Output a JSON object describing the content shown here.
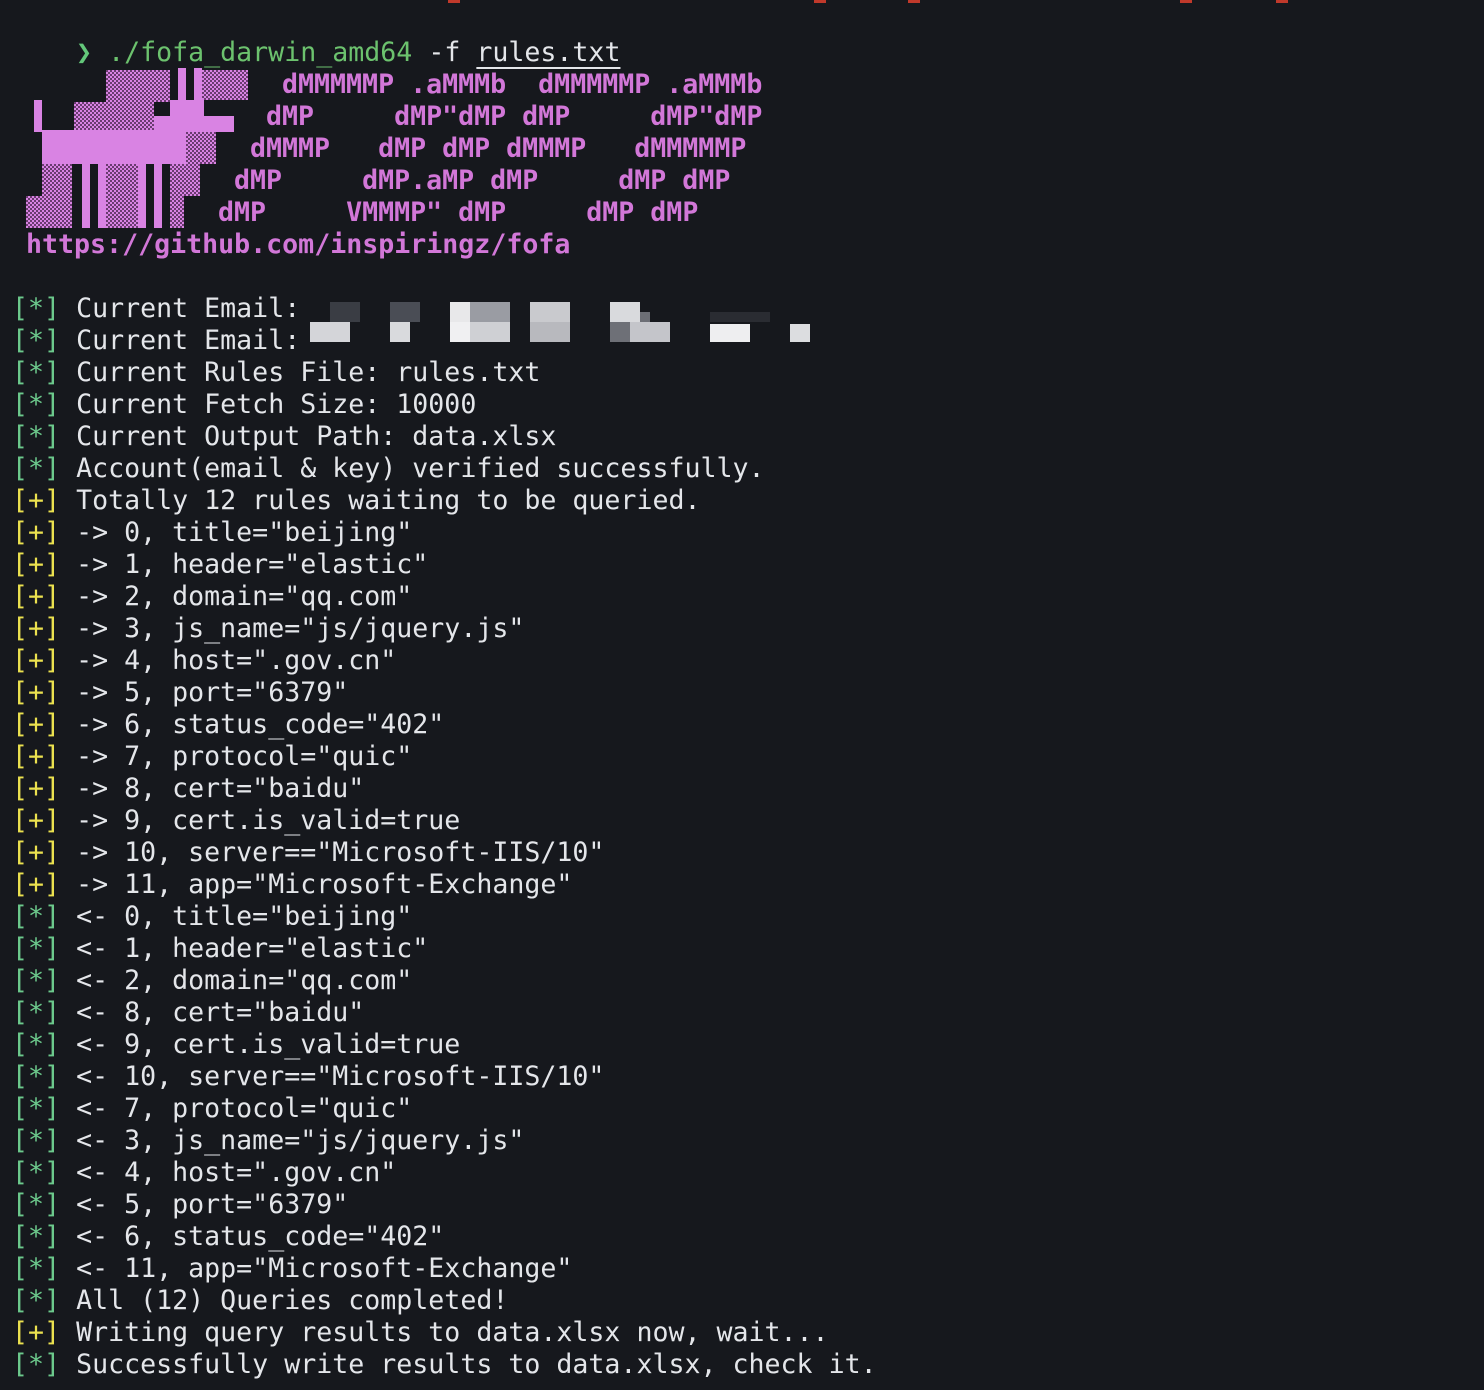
{
  "prompt": {
    "symbol": "❯",
    "command": "./fofa_darwin_amd64",
    "flag": "-f",
    "file": "rules.txt"
  },
  "banner": {
    "lines": [
      "dMMMMMP .aMMMb  dMMMMMP .aMMMb",
      "dMP     dMP\"dMP dMP     dMP\"dMP",
      "dMMMP   dMP dMP dMMMP   dMMMMMP",
      "dMP     dMP.aMP dMP     dMP dMP",
      "dMP     VMMMP\" dMP     dMP dMP"
    ],
    "url": "https://github.com/inspiringz/fofa",
    "logo": "pixel-fox-logo"
  },
  "colors": {
    "background": "#16181d",
    "text": "#e4e6ea",
    "star_tag": "#6cc98c",
    "plus_tag": "#ebe14f",
    "banner": "#d277d8",
    "prompt": "#6cc26e"
  },
  "log": [
    {
      "tag": "[*]",
      "type": "star",
      "text": "Current Email: ",
      "redacted": true
    },
    {
      "tag": "[*]",
      "type": "star",
      "text": "Current Email: ",
      "redacted": true
    },
    {
      "tag": "[*]",
      "type": "star",
      "text": "Current Rules File: rules.txt"
    },
    {
      "tag": "[*]",
      "type": "star",
      "text": "Current Fetch Size: 10000"
    },
    {
      "tag": "[*]",
      "type": "star",
      "text": "Current Output Path: data.xlsx"
    },
    {
      "tag": "[*]",
      "type": "star",
      "text": "Account(email & key) verified successfully."
    },
    {
      "tag": "[+]",
      "type": "plus",
      "text": "Totally 12 rules waiting to be queried."
    },
    {
      "tag": "[+]",
      "type": "plus",
      "text": "-> 0, title=\"beijing\""
    },
    {
      "tag": "[+]",
      "type": "plus",
      "text": "-> 1, header=\"elastic\""
    },
    {
      "tag": "[+]",
      "type": "plus",
      "text": "-> 2, domain=\"qq.com\""
    },
    {
      "tag": "[+]",
      "type": "plus",
      "text": "-> 3, js_name=\"js/jquery.js\""
    },
    {
      "tag": "[+]",
      "type": "plus",
      "text": "-> 4, host=\".gov.cn\""
    },
    {
      "tag": "[+]",
      "type": "plus",
      "text": "-> 5, port=\"6379\""
    },
    {
      "tag": "[+]",
      "type": "plus",
      "text": "-> 6, status_code=\"402\""
    },
    {
      "tag": "[+]",
      "type": "plus",
      "text": "-> 7, protocol=\"quic\""
    },
    {
      "tag": "[+]",
      "type": "plus",
      "text": "-> 8, cert=\"baidu\""
    },
    {
      "tag": "[+]",
      "type": "plus",
      "text": "-> 9, cert.is_valid=true"
    },
    {
      "tag": "[+]",
      "type": "plus",
      "text": "-> 10, server==\"Microsoft-IIS/10\""
    },
    {
      "tag": "[+]",
      "type": "plus",
      "text": "-> 11, app=\"Microsoft-Exchange\""
    },
    {
      "tag": "[*]",
      "type": "star",
      "text": "<- 0, title=\"beijing\""
    },
    {
      "tag": "[*]",
      "type": "star",
      "text": "<- 1, header=\"elastic\""
    },
    {
      "tag": "[*]",
      "type": "star",
      "text": "<- 2, domain=\"qq.com\""
    },
    {
      "tag": "[*]",
      "type": "star",
      "text": "<- 8, cert=\"baidu\""
    },
    {
      "tag": "[*]",
      "type": "star",
      "text": "<- 9, cert.is_valid=true"
    },
    {
      "tag": "[*]",
      "type": "star",
      "text": "<- 10, server==\"Microsoft-IIS/10\""
    },
    {
      "tag": "[*]",
      "type": "star",
      "text": "<- 7, protocol=\"quic\""
    },
    {
      "tag": "[*]",
      "type": "star",
      "text": "<- 3, js_name=\"js/jquery.js\""
    },
    {
      "tag": "[*]",
      "type": "star",
      "text": "<- 4, host=\".gov.cn\""
    },
    {
      "tag": "[*]",
      "type": "star",
      "text": "<- 5, port=\"6379\""
    },
    {
      "tag": "[*]",
      "type": "star",
      "text": "<- 6, status_code=\"402\""
    },
    {
      "tag": "[*]",
      "type": "star",
      "text": "<- 11, app=\"Microsoft-Exchange\""
    },
    {
      "tag": "[*]",
      "type": "star",
      "text": "All (12) Queries completed!"
    },
    {
      "tag": "[+]",
      "type": "plus",
      "text": "Writing query results to data.xlsx now, wait..."
    },
    {
      "tag": "[*]",
      "type": "star",
      "text": "Successfully write results to data.xlsx, check it."
    }
  ]
}
